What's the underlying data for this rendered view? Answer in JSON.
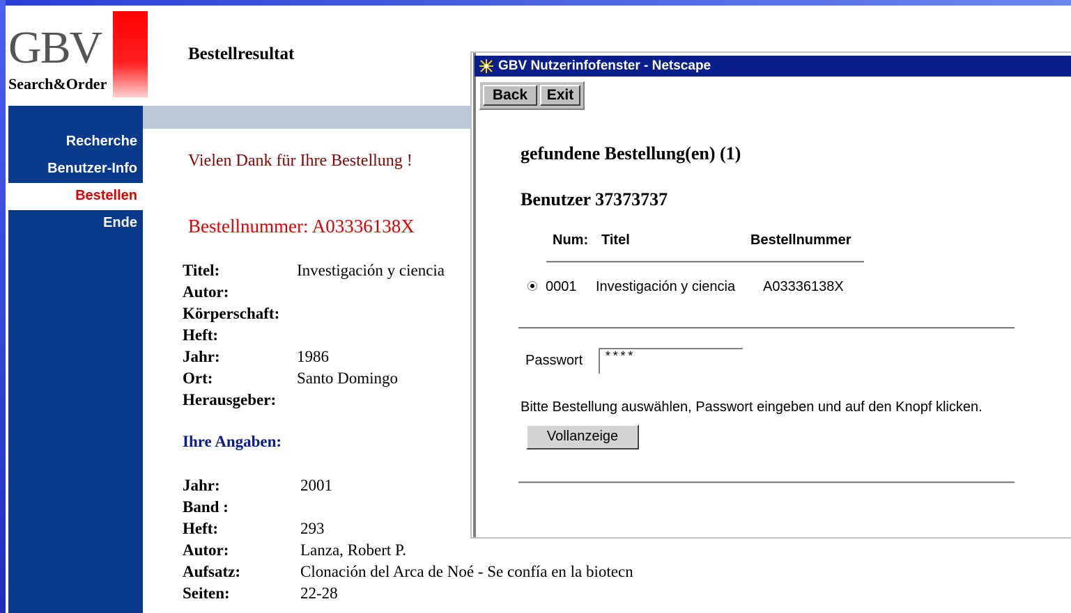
{
  "logo": {
    "main": "GBV",
    "sub": "Search&Order"
  },
  "page": {
    "title": "Bestellresultat"
  },
  "sidebar": {
    "items": [
      {
        "label": "Recherche"
      },
      {
        "label": "Benutzer-Info"
      },
      {
        "label": "Bestellen"
      },
      {
        "label": "Ende"
      }
    ]
  },
  "main": {
    "thanks": "Vielen Dank für Ihre Bestellung !",
    "order_number": "Bestellnummer: A03336138X",
    "fields": [
      {
        "label": "Titel:",
        "value": "Investigación y ciencia"
      },
      {
        "label": "Autor:",
        "value": ""
      },
      {
        "label": "Körperschaft:",
        "value": ""
      },
      {
        "label": "Heft:",
        "value": ""
      },
      {
        "label": "Jahr:",
        "value": "1986"
      },
      {
        "label": "Ort:",
        "value": "Santo Domingo"
      },
      {
        "label": "Herausgeber:",
        "value": ""
      }
    ],
    "angaben_heading": "Ihre Angaben:",
    "angaben": [
      {
        "label": "Jahr:",
        "value": "2001"
      },
      {
        "label": "Band :",
        "value": ""
      },
      {
        "label": "Heft:",
        "value": "293"
      },
      {
        "label": "Autor:",
        "value": "Lanza, Robert P."
      },
      {
        "label": "Aufsatz:",
        "value": "Clonación del Arca de Noé - Se confía en la biotecn"
      },
      {
        "label": "Seiten:",
        "value": "22-28"
      }
    ]
  },
  "popup": {
    "title": "GBV Nutzerinfofenster - Netscape",
    "back": "Back",
    "exit": "Exit",
    "heading": "gefundene Bestellung(en) (1)",
    "user": "Benutzer 37373737",
    "columns": {
      "num": "Num:",
      "title": "Titel",
      "order": "Bestellnummer"
    },
    "row": {
      "num": "0001",
      "title": "Investigación y ciencia",
      "order": "A03336138X"
    },
    "password_label": "Passwort",
    "password_value": "****",
    "hint": "Bitte Bestellung auswählen, Passwort eingeben und auf den Knopf klicken.",
    "button": "Vollanzeige"
  }
}
